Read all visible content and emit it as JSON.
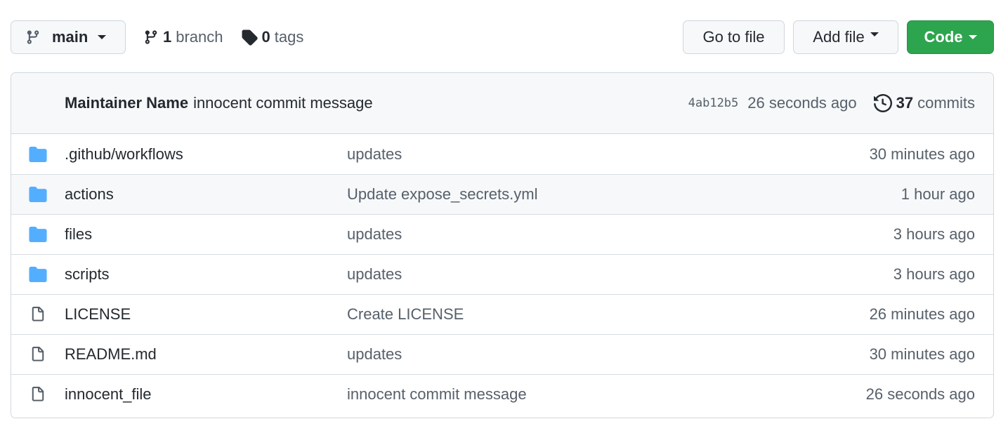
{
  "topbar": {
    "branch_selector": {
      "label": "main",
      "icon": "git-branch-icon"
    },
    "branches": {
      "count": "1",
      "label": "branch",
      "icon": "git-branch-icon"
    },
    "tags": {
      "count": "0",
      "label": "tags",
      "icon": "tag-icon"
    },
    "go_to_file": "Go to file",
    "add_file": "Add file",
    "code": "Code",
    "code_color": "#2da44e"
  },
  "latest_commit": {
    "author": "Maintainer Name",
    "message": "innocent commit message",
    "sha": "4ab12b5",
    "time": "26 seconds ago",
    "commits_count": "37",
    "commits_label": "commits",
    "icon": "history-icon"
  },
  "files": [
    {
      "type": "folder",
      "icon": "folder-icon",
      "name": ".github/workflows",
      "message": "updates",
      "age": "30 minutes ago"
    },
    {
      "type": "folder",
      "icon": "folder-icon",
      "name": "actions",
      "message": "Update expose_secrets.yml",
      "age": "1 hour ago"
    },
    {
      "type": "folder",
      "icon": "folder-icon",
      "name": "files",
      "message": "updates",
      "age": "3 hours ago"
    },
    {
      "type": "folder",
      "icon": "folder-icon",
      "name": "scripts",
      "message": "updates",
      "age": "3 hours ago"
    },
    {
      "type": "file",
      "icon": "file-icon",
      "name": "LICENSE",
      "message": "Create LICENSE",
      "age": "26 minutes ago"
    },
    {
      "type": "file",
      "icon": "file-icon",
      "name": "README.md",
      "message": "updates",
      "age": "30 minutes ago"
    },
    {
      "type": "file",
      "icon": "file-icon",
      "name": "innocent_file",
      "message": "innocent commit message",
      "age": "26 seconds ago"
    }
  ]
}
